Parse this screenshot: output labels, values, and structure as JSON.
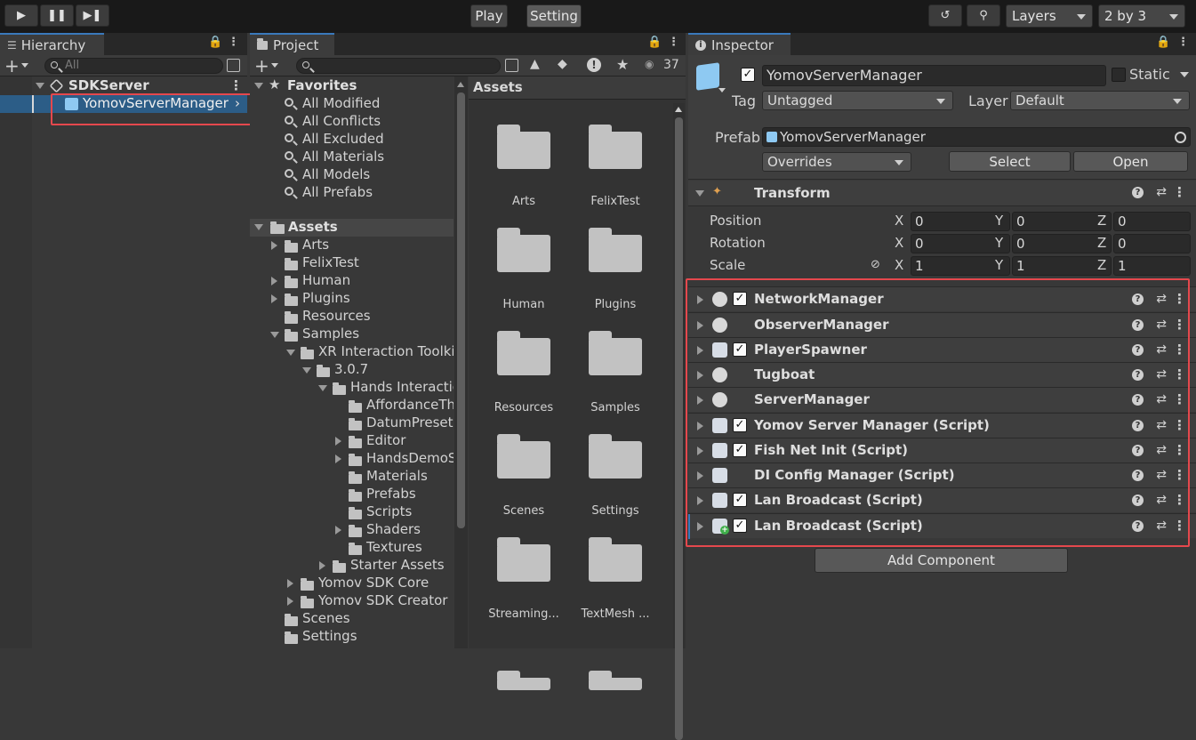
{
  "toolbar": {
    "play_label": "Play",
    "setting_label": "Setting",
    "layers_label": "Layers",
    "layout_label": "2 by 3"
  },
  "hierarchy": {
    "tab_label": "Hierarchy",
    "search_placeholder": "All",
    "scene_name": "SDKServer",
    "selected_object": "YomovServerManager"
  },
  "project": {
    "tab_label": "Project",
    "badge_count": "37",
    "favorites_label": "Favorites",
    "favorites": [
      "All Modified",
      "All Conflicts",
      "All Excluded",
      "All Materials",
      "All Models",
      "All Prefabs"
    ],
    "assets_root": "Assets",
    "tree": [
      {
        "label": "Arts",
        "depth": 0,
        "arrow": "right"
      },
      {
        "label": "FelixTest",
        "depth": 0,
        "arrow": "none"
      },
      {
        "label": "Human",
        "depth": 0,
        "arrow": "right"
      },
      {
        "label": "Plugins",
        "depth": 0,
        "arrow": "right"
      },
      {
        "label": "Resources",
        "depth": 0,
        "arrow": "none"
      },
      {
        "label": "Samples",
        "depth": 0,
        "arrow": "down"
      },
      {
        "label": "XR Interaction Toolki",
        "depth": 1,
        "arrow": "down"
      },
      {
        "label": "3.0.7",
        "depth": 2,
        "arrow": "down"
      },
      {
        "label": "Hands Interactic",
        "depth": 3,
        "arrow": "down"
      },
      {
        "label": "AffordanceTh",
        "depth": 4,
        "arrow": "none"
      },
      {
        "label": "DatumPresets",
        "depth": 4,
        "arrow": "none"
      },
      {
        "label": "Editor",
        "depth": 4,
        "arrow": "right"
      },
      {
        "label": "HandsDemoS",
        "depth": 4,
        "arrow": "right"
      },
      {
        "label": "Materials",
        "depth": 4,
        "arrow": "none"
      },
      {
        "label": "Prefabs",
        "depth": 4,
        "arrow": "none"
      },
      {
        "label": "Scripts",
        "depth": 4,
        "arrow": "none"
      },
      {
        "label": "Shaders",
        "depth": 4,
        "arrow": "right"
      },
      {
        "label": "Textures",
        "depth": 4,
        "arrow": "none"
      },
      {
        "label": "Starter Assets",
        "depth": 3,
        "arrow": "right"
      },
      {
        "label": "Yomov SDK Core",
        "depth": 1,
        "arrow": "right"
      },
      {
        "label": "Yomov SDK Creator",
        "depth": 1,
        "arrow": "right"
      },
      {
        "label": "Scenes",
        "depth": 0,
        "arrow": "none"
      },
      {
        "label": "Settings",
        "depth": 0,
        "arrow": "none"
      }
    ],
    "grid_header": "Assets",
    "grid_items": [
      "Arts",
      "FelixTest",
      "Human",
      "Plugins",
      "Resources",
      "Samples",
      "Scenes",
      "Settings",
      "Streaming...",
      "TextMesh ..."
    ]
  },
  "inspector": {
    "tab_label": "Inspector",
    "object_name": "YomovServerManager",
    "static_label": "Static",
    "tag_label": "Tag",
    "tag_value": "Untagged",
    "layer_label": "Layer",
    "layer_value": "Default",
    "prefab_label": "Prefab",
    "prefab_value": "YomovServerManager",
    "overrides_label": "Overrides",
    "select_label": "Select",
    "open_label": "Open",
    "transform_label": "Transform",
    "transform": [
      {
        "label": "Position",
        "x": "0",
        "y": "0",
        "z": "0"
      },
      {
        "label": "Rotation",
        "x": "0",
        "y": "0",
        "z": "0"
      },
      {
        "label": "Scale",
        "x": "1",
        "y": "1",
        "z": "1"
      }
    ],
    "axis": {
      "x": "X",
      "y": "Y",
      "z": "Z"
    },
    "components": [
      {
        "name": "NetworkManager",
        "checked": true,
        "icon": "network-icon"
      },
      {
        "name": "ObserverManager",
        "checked": false,
        "icon": "network-icon"
      },
      {
        "name": "PlayerSpawner",
        "checked": true,
        "icon": "script-icon"
      },
      {
        "name": "Tugboat",
        "checked": false,
        "icon": "network-icon"
      },
      {
        "name": "ServerManager",
        "checked": false,
        "icon": "network-icon"
      },
      {
        "name": "Yomov Server Manager (Script)",
        "checked": true,
        "icon": "script-icon"
      },
      {
        "name": "Fish Net Init (Script)",
        "checked": true,
        "icon": "script-icon"
      },
      {
        "name": "DI Config Manager (Script)",
        "checked": false,
        "icon": "script-icon"
      },
      {
        "name": "Lan Broadcast (Script)",
        "checked": true,
        "icon": "script-icon"
      },
      {
        "name": "Lan Broadcast (Script)",
        "checked": true,
        "icon": "script-add-icon"
      }
    ],
    "add_component_label": "Add Component"
  },
  "colors": {
    "selection": "#2c5d87",
    "highlight": "#e5484d",
    "tab_accent": "#3a79bb"
  }
}
